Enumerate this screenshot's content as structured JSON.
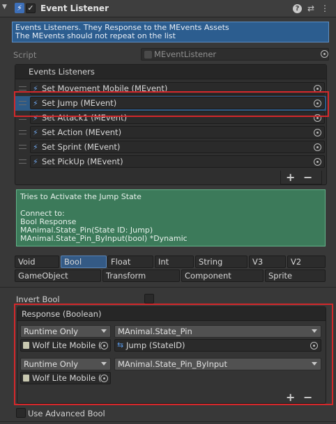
{
  "header": {
    "title": "Event Listener",
    "enabled_check": "✓",
    "foldout_glyph": "▼",
    "script_glyph": "⚡",
    "help_glyph": "?",
    "settings_glyph": "⇄",
    "menu_glyph": "⋮"
  },
  "info_box": {
    "line1": "Events Listeners. They Response to the MEvents Assets",
    "line2": "The MEvents should not repeat on the list"
  },
  "script_field": {
    "label": "Script",
    "value": "MEventListener"
  },
  "event_listeners": {
    "header": "Events Listeners",
    "items": [
      {
        "label": "Set Movement Mobile (MEvent)"
      },
      {
        "label": "Set Jump (MEvent)",
        "selected": true
      },
      {
        "label": "Set Attack1 (MEvent)"
      },
      {
        "label": "Set Action (MEvent)"
      },
      {
        "label": "Set Sprint (MEvent)"
      },
      {
        "label": "Set PickUp (MEvent)"
      }
    ],
    "add_label": "+",
    "remove_label": "−"
  },
  "description": {
    "line1": "Tries to Activate  the Jump State",
    "line2": "",
    "line3": "Connect to:",
    "line4": "Bool Response",
    "line5": "MAnimal.State_Pin(State ID: Jump)",
    "line6": "MAnimal.State_Pin_ByInput(bool) *Dynamic"
  },
  "type_tabs": {
    "row1": [
      "Void",
      "Bool",
      "Float",
      "Int",
      "String",
      "V3",
      "V2"
    ],
    "row2": [
      "GameObject",
      "Transform",
      "Component",
      "Sprite"
    ],
    "selected": "Bool"
  },
  "invert_bool": {
    "label": "Invert Bool",
    "checked": false
  },
  "response": {
    "header": "Response (Boolean)",
    "entries": [
      {
        "mode": "Runtime Only",
        "function": "MAnimal.State_Pin",
        "target": "Wolf Lite Mobile (",
        "argument": "Jump (StateID)"
      },
      {
        "mode": "Runtime Only",
        "function": "MAnimal.State_Pin_ByInput",
        "target": "Wolf Lite Mobile ("
      }
    ],
    "add_label": "+",
    "remove_label": "−"
  },
  "advanced": {
    "label": "Use Advanced Bool",
    "checked": false
  },
  "colors": {
    "panel_bg": "#383838",
    "info_blue": "#2c5d8f",
    "note_green": "#3c7a5a",
    "selection_blue": "#2d5a86",
    "highlight_red": "#d4282b"
  }
}
